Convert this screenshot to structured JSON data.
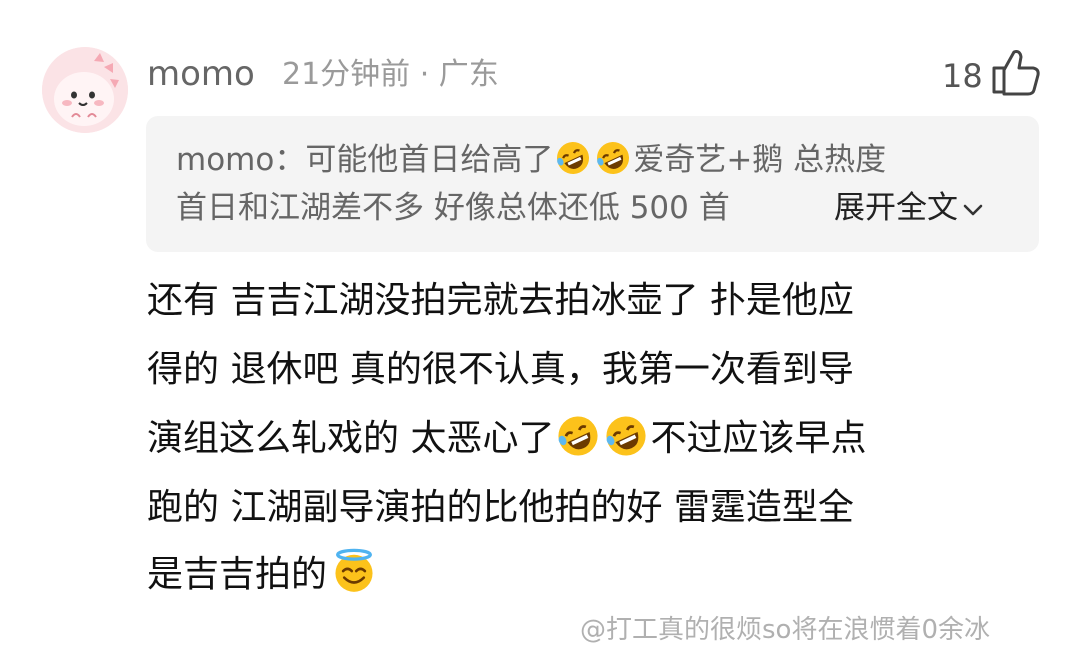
{
  "comment": {
    "username": "momo",
    "meta": "21分钟前 · 广东",
    "likes": "18",
    "avatar_icon": "pink-dinosaur-avatar",
    "like_icon": "thumbs-up-icon"
  },
  "quote": {
    "prefix": "momo：可能他首日给高了",
    "line1_after": "爱奇艺+鹅 总热度",
    "line2": "首日和江湖差不多 好像总体还低 500 首",
    "expand_label": "展开全文"
  },
  "body": {
    "line1": "还有 吉吉江湖没拍完就去拍冰壶了 扑是他应",
    "line2": "得的 退休吧 真的很不认真，我第一次看到导",
    "line3_pre": "演组这么轧戏的 太恶心了",
    "line3_post": "不过应该早点",
    "line4": "跑的 江湖副导演拍的比他拍的好 雷霆造型全",
    "line5": "是吉吉拍的"
  },
  "watermark": {
    "text": "@打工真的很烦so将在浪惯着0余冰"
  },
  "colors": {
    "accent_avatar_bg": "#fbe3e6",
    "quote_bg": "#f4f4f4",
    "text_primary": "#111111",
    "text_secondary": "#666666",
    "text_meta": "#9a9a9a"
  }
}
